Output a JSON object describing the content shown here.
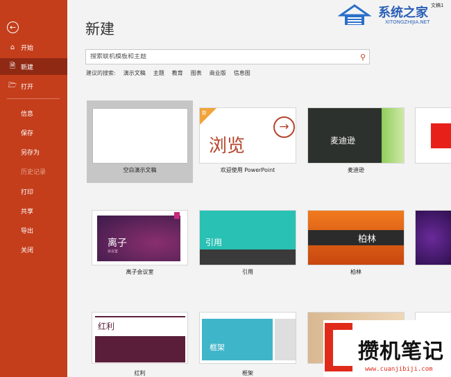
{
  "sidebar": {
    "back_icon": "back-arrow-icon",
    "items": [
      {
        "label": "开始",
        "icon": "home-icon"
      },
      {
        "label": "新建",
        "icon": "new-file-icon",
        "active": true
      },
      {
        "label": "打开",
        "icon": "open-folder-icon"
      },
      {
        "label": "信息"
      },
      {
        "label": "保存"
      },
      {
        "label": "另存为"
      },
      {
        "label": "历史记录",
        "disabled": true
      },
      {
        "label": "打印"
      },
      {
        "label": "共享"
      },
      {
        "label": "导出"
      },
      {
        "label": "关闭"
      }
    ]
  },
  "main": {
    "title": "新建",
    "search_placeholder": "搜索联机模板和主题",
    "suggestions_label": "建议的搜索:",
    "suggestions": [
      "演示文稿",
      "主题",
      "教育",
      "图表",
      "商业版",
      "信息图"
    ]
  },
  "templates": [
    {
      "caption": "空白演示文稿"
    },
    {
      "caption": "欢迎使用 PowerPoint",
      "thumb_text": "浏览",
      "badge": "新"
    },
    {
      "caption": "麦迪逊",
      "thumb_text": "麦迪逊"
    },
    {
      "caption": "离子会议室",
      "thumb_text": "离子",
      "thumb_sub": "会议室"
    },
    {
      "caption": "引用",
      "thumb_text": "引用"
    },
    {
      "caption": "柏林",
      "thumb_text": "柏林"
    },
    {
      "caption": "红利",
      "thumb_text": "红利"
    },
    {
      "caption": "框架",
      "thumb_text": "框架"
    }
  ],
  "watermark": {
    "top_title": "系统之家",
    "top_url": "XITONGZHIJIA.NET",
    "top_corner": "文稿1",
    "bottom_title": "攒机笔记",
    "bottom_url": "www.cuanjibiji.com"
  },
  "colors": {
    "accent": "#c43e1c",
    "active": "#8f2914"
  }
}
